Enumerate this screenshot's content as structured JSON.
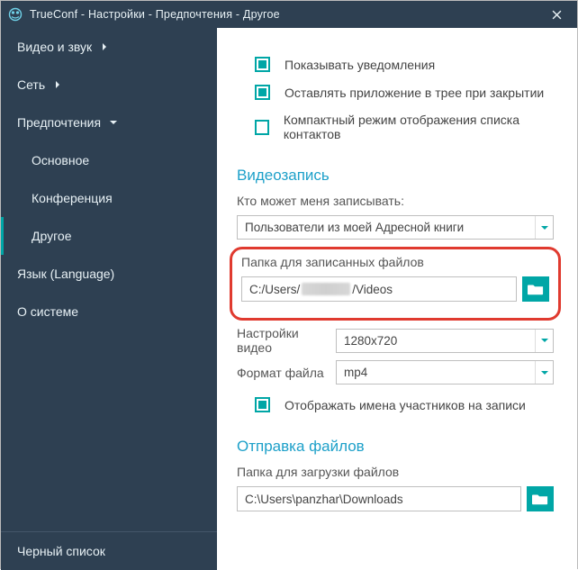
{
  "window": {
    "title": "TrueConf - Настройки - Предпочтения - Другое"
  },
  "sidebar": {
    "items": [
      {
        "label": "Видео и звук",
        "expandable": "right"
      },
      {
        "label": "Сеть",
        "expandable": "right"
      },
      {
        "label": "Предпочтения",
        "expandable": "down"
      },
      {
        "label": "Основное",
        "sub": true
      },
      {
        "label": "Конференция",
        "sub": true
      },
      {
        "label": "Другое",
        "sub": true,
        "active": true
      },
      {
        "label": "Язык (Language)"
      },
      {
        "label": "О системе"
      }
    ],
    "bottom_label": "Черный список"
  },
  "main": {
    "checks": {
      "notify": "Показывать уведомления",
      "tray": "Оставлять приложение в трее при закрытии",
      "compact": "Компактный режим отображения списка контактов"
    },
    "video": {
      "heading": "Видеозапись",
      "who_label": "Кто может меня записывать:",
      "who_value": "Пользователи из моей Адресной книги",
      "folder_label": "Папка для записанных файлов",
      "folder_prefix": "C:/Users/",
      "folder_suffix": "/Videos",
      "settings_label": "Настройки видео",
      "settings_value": "1280x720",
      "format_label": "Формат файла",
      "format_value": "mp4",
      "names_check": "Отображать имена участников на записи"
    },
    "send": {
      "heading": "Отправка файлов",
      "folder_label": "Папка для загрузки файлов",
      "folder_value": "C:\\Users\\panzhar\\Downloads"
    }
  }
}
